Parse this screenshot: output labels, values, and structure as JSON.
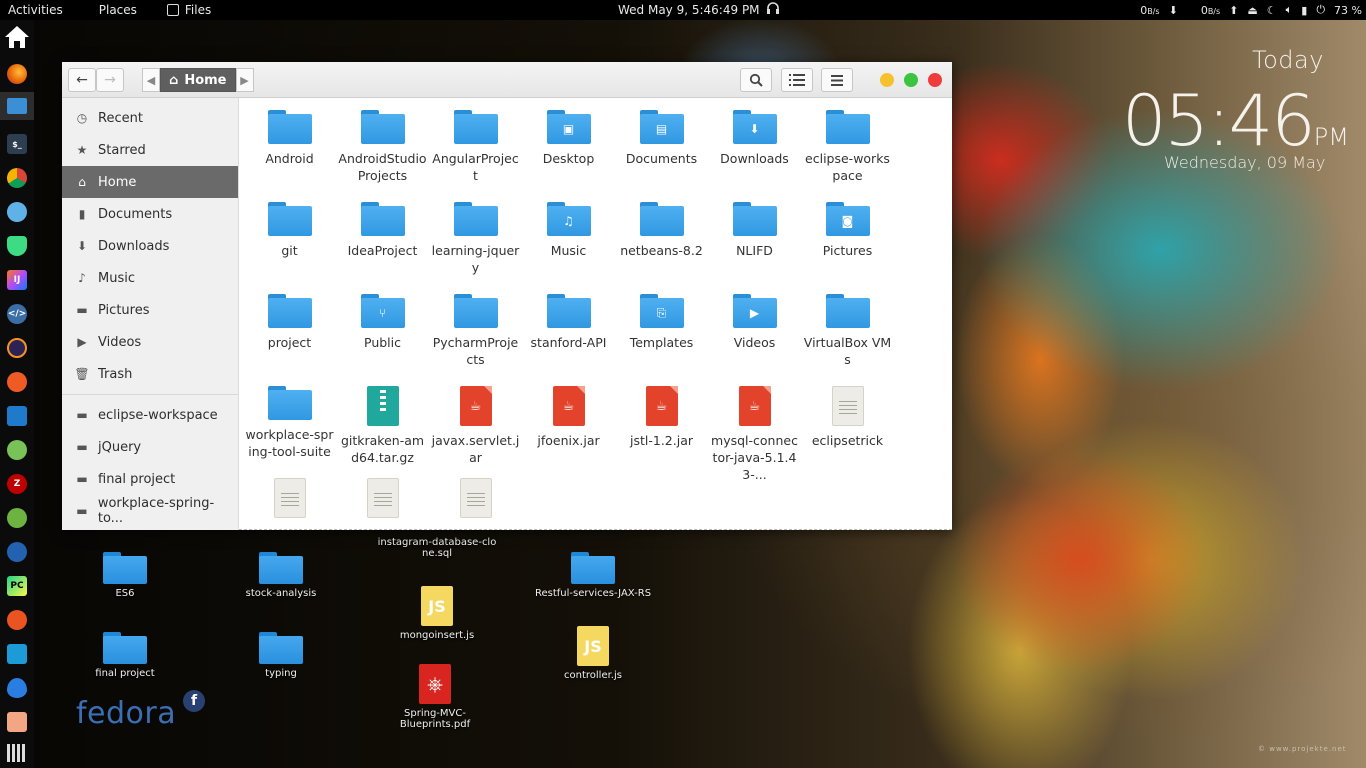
{
  "topbar": {
    "activities": "Activities",
    "places": "Places",
    "files": "Files",
    "clock": "Wed May  9,  5:46:49 PM",
    "net_down": "0",
    "net_down_unit": "B/s",
    "net_up": "0",
    "net_up_unit": "B/s",
    "battery": "73 %"
  },
  "widget": {
    "today": "Today",
    "time": "05:46",
    "ampm": "PM",
    "date": "Wednesday, 09 May"
  },
  "watermark": "© www.projekte.net",
  "window": {
    "path_home": "Home",
    "colors": {
      "minimize": "#f6c12d",
      "maximize": "#3cc33f",
      "close": "#ef3d3d"
    }
  },
  "sidebar": {
    "items": [
      {
        "label": "Recent",
        "icon": "clock-icon"
      },
      {
        "label": "Starred",
        "icon": "star-icon"
      },
      {
        "label": "Home",
        "icon": "home-icon"
      },
      {
        "label": "Documents",
        "icon": "document-icon"
      },
      {
        "label": "Downloads",
        "icon": "download-icon"
      },
      {
        "label": "Music",
        "icon": "music-icon"
      },
      {
        "label": "Pictures",
        "icon": "pictures-icon"
      },
      {
        "label": "Videos",
        "icon": "video-icon"
      },
      {
        "label": "Trash",
        "icon": "trash-icon"
      }
    ],
    "bookmarks": [
      {
        "label": "eclipse-workspace"
      },
      {
        "label": "jQuery"
      },
      {
        "label": "final project"
      },
      {
        "label": "workplace-spring-to..."
      }
    ]
  },
  "files": [
    {
      "label": "Android",
      "kind": "folder"
    },
    {
      "label": "AndroidStudio Projects",
      "kind": "folder"
    },
    {
      "label": "AngularProject",
      "kind": "folder"
    },
    {
      "label": "Desktop",
      "kind": "folder",
      "emblem": "▣"
    },
    {
      "label": "Documents",
      "kind": "folder",
      "emblem": "▤"
    },
    {
      "label": "Downloads",
      "kind": "folder",
      "emblem": "⬇"
    },
    {
      "label": "eclipse-workspace",
      "kind": "folder"
    },
    {
      "label": "git",
      "kind": "folder"
    },
    {
      "label": "IdeaProject",
      "kind": "folder"
    },
    {
      "label": "learning-jquery",
      "kind": "folder"
    },
    {
      "label": "Music",
      "kind": "folder",
      "emblem": "♫"
    },
    {
      "label": "netbeans-8.2",
      "kind": "folder"
    },
    {
      "label": "NLIFD",
      "kind": "folder"
    },
    {
      "label": "Pictures",
      "kind": "folder",
      "emblem": "◙"
    },
    {
      "label": "project",
      "kind": "folder"
    },
    {
      "label": "Public",
      "kind": "folder",
      "emblem": "⑂"
    },
    {
      "label": "PycharmProjects",
      "kind": "folder"
    },
    {
      "label": "stanford-API",
      "kind": "folder"
    },
    {
      "label": "Templates",
      "kind": "folder",
      "emblem": "⎘"
    },
    {
      "label": "Videos",
      "kind": "folder",
      "emblem": "▶"
    },
    {
      "label": "VirtualBox VMs",
      "kind": "folder"
    },
    {
      "label": "workplace-spring-tool-suite",
      "kind": "folder"
    },
    {
      "label": "gitkraken-amd64.tar.gz",
      "kind": "archive"
    },
    {
      "label": "javax.servlet.jar",
      "kind": "jar"
    },
    {
      "label": "jfoenix.jar",
      "kind": "jar"
    },
    {
      "label": "jstl-1.2.jar",
      "kind": "jar"
    },
    {
      "label": "mysql-connector-java-5.1.43-...",
      "kind": "jar"
    },
    {
      "label": "eclipsetrick",
      "kind": "text"
    },
    {
      "label": "",
      "kind": "text"
    },
    {
      "label": "",
      "kind": "text"
    },
    {
      "label": "",
      "kind": "text"
    }
  ],
  "desktop": [
    {
      "label": "ES6",
      "kind": "folder"
    },
    {
      "label": "stock-analysis",
      "kind": "folder"
    },
    {
      "label": "instagram-database-clone.sql",
      "kind": "none"
    },
    {
      "label": "Restful-services-JAX-RS",
      "kind": "folder"
    },
    {
      "label": "mongoinsert.js",
      "kind": "js"
    },
    {
      "label": "final project",
      "kind": "folder"
    },
    {
      "label": "typing",
      "kind": "folder"
    },
    {
      "label": "controller.js",
      "kind": "js"
    },
    {
      "label": "Spring-MVC-Blueprints.pdf",
      "kind": "pdf"
    }
  ],
  "desktop_js_glyph": "JS",
  "fedora_logo": "fedora"
}
